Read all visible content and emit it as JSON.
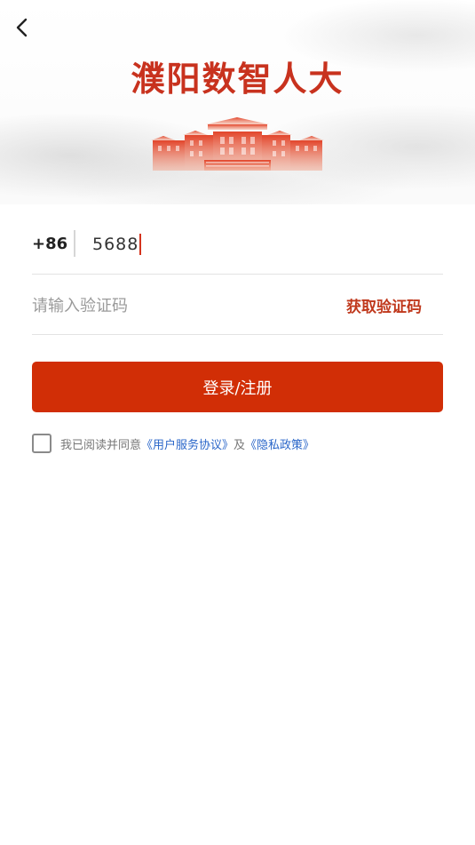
{
  "header": {
    "back_icon": "chevron-left-icon",
    "title": "濮阳数智人大",
    "illustration": "people-congress-building"
  },
  "form": {
    "country_code": "+86",
    "phone_value": "5688",
    "code_placeholder": "请输入验证码",
    "get_code_label": "获取验证码",
    "submit_label": "登录/注册"
  },
  "agreement": {
    "checked": false,
    "prefix": "我已阅读并同意",
    "user_agreement": "《用户服务协议》",
    "and": "及",
    "privacy_policy": "《隐私政策》"
  },
  "colors": {
    "primary": "#d12e06",
    "title": "#c8321e",
    "link": "#2a66c9"
  }
}
